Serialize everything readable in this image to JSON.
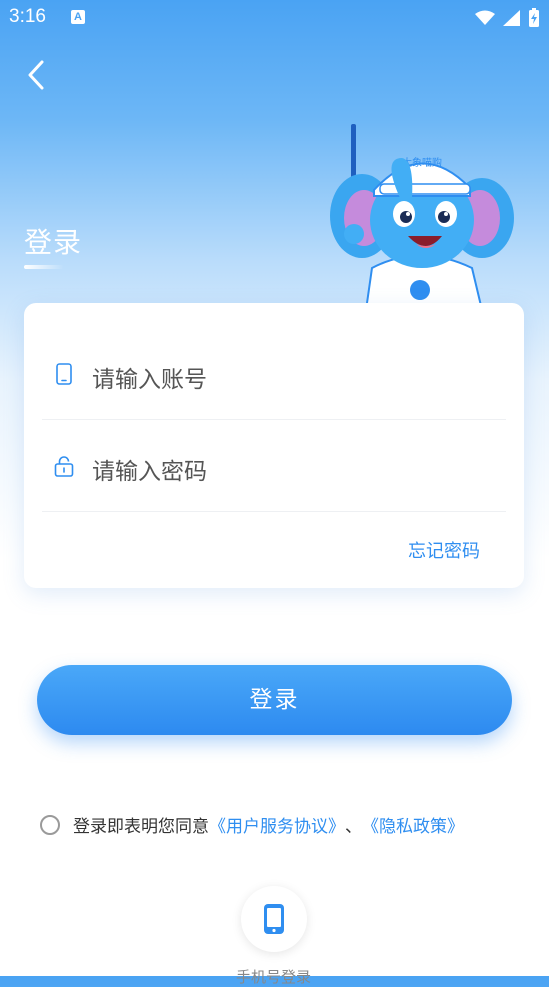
{
  "status_bar": {
    "time": "3:16",
    "notification_icon_letter": "A"
  },
  "header": {
    "title": "登录"
  },
  "form": {
    "account_placeholder": "请输入账号",
    "password_placeholder": "请输入密码",
    "forgot_password": "忘记密码"
  },
  "actions": {
    "login_button": "登录"
  },
  "agreement": {
    "prefix": "登录即表明您同意",
    "user_agreement": "《用户服务协议》",
    "separator": "、",
    "privacy_policy": "《隐私政策》"
  },
  "alt_login": {
    "phone_label": "手机号登录"
  },
  "mascot": {
    "cap_text": "大象喵购"
  },
  "colors": {
    "accent": "#2f8ef0",
    "header_top": "#4aa3f3",
    "button": "#2d8af0"
  }
}
